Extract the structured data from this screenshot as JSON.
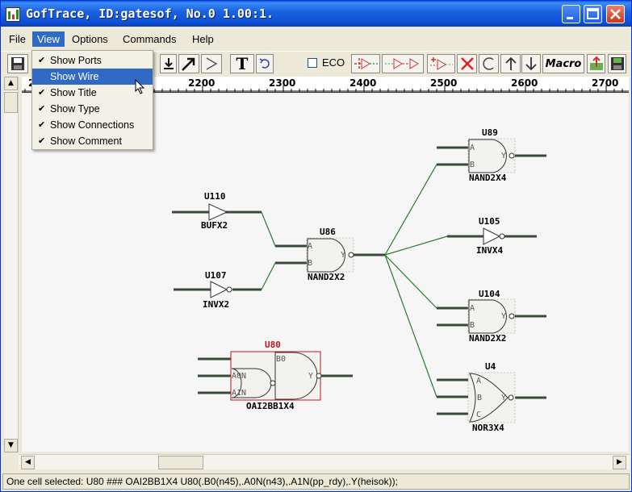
{
  "window": {
    "title": "GofTrace, ID:gatesof, No.0 1.00:1."
  },
  "menubar": {
    "items": [
      "File",
      "View",
      "Options",
      "Commands",
      "Help"
    ],
    "active": "View"
  },
  "view_menu": {
    "items": [
      {
        "label": "Show Ports",
        "checked": true
      },
      {
        "label": "Show Wire",
        "checked": false,
        "highlighted": true
      },
      {
        "label": "Show Title",
        "checked": true
      },
      {
        "label": "Show Type",
        "checked": true
      },
      {
        "label": "Show Connections",
        "checked": true
      },
      {
        "label": "Show Comment",
        "checked": true
      }
    ]
  },
  "toolbar": {
    "eco_label": "ECO",
    "macro_label": "Macro",
    "text_tool_label": "T"
  },
  "ruler": {
    "ticks": [
      "2200",
      "2300",
      "2400",
      "2500",
      "2600",
      "2700"
    ],
    "partial_left": "2"
  },
  "schematic": {
    "cells": [
      {
        "name": "U110",
        "type": "BUFX2"
      },
      {
        "name": "U107",
        "type": "INVX2"
      },
      {
        "name": "U86",
        "type": "NAND2X2",
        "ports": [
          "A",
          "B",
          "Y"
        ]
      },
      {
        "name": "U80",
        "type": "OAI2BB1X4",
        "ports": [
          "B0",
          "A0N",
          "A1N",
          "Y"
        ],
        "selected": true
      },
      {
        "name": "U89",
        "type": "NAND2X4",
        "ports": [
          "A",
          "B",
          "Y"
        ]
      },
      {
        "name": "U105",
        "type": "INVX4"
      },
      {
        "name": "U104",
        "type": "NAND2X2",
        "ports": [
          "A",
          "B",
          "Y"
        ]
      },
      {
        "name": "U4",
        "type": "NOR3X4",
        "ports": [
          "A",
          "B",
          "C",
          "Y"
        ]
      }
    ],
    "colors": {
      "wire": "#2d7a2d",
      "pin": "#3a4a3a",
      "selected": "#c0161a"
    }
  },
  "status": {
    "text": "One cell selected: U80 ### OAI2BB1X4 U80(.B0(n45),.A0N(n43),.A1N(pp_rdy),.Y(heisok));"
  }
}
